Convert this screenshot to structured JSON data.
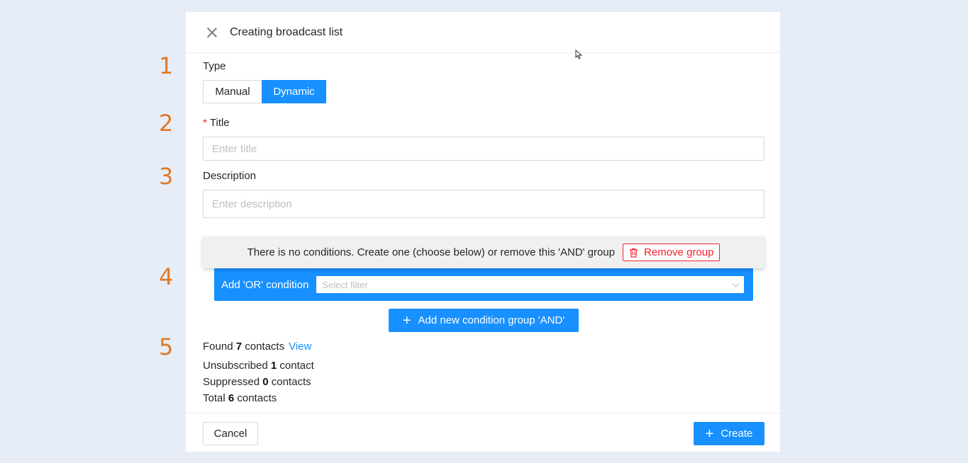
{
  "steps": [
    "1",
    "2",
    "3",
    "4",
    "5"
  ],
  "modal": {
    "title": "Creating broadcast list"
  },
  "type_field": {
    "label": "Type",
    "options": [
      "Manual",
      "Dynamic"
    ],
    "selected": "Dynamic"
  },
  "title_field": {
    "required_mark": "*",
    "label": "Title",
    "value": "",
    "placeholder": "Enter title"
  },
  "description_field": {
    "label": "Description",
    "value": "",
    "placeholder": "Enter description"
  },
  "condition_group": {
    "empty_message": "There is no conditions. Create one (choose below) or remove this 'AND' group",
    "remove_label": "Remove group",
    "or_label": "Add 'OR' condition",
    "select_placeholder": "Select filter"
  },
  "add_group_label": "Add new condition group 'AND'",
  "stats": {
    "found_prefix": "Found",
    "found_count": "7",
    "found_suffix": "contacts",
    "view_label": "View",
    "unsubscribed_prefix": "Unsubscribed",
    "unsubscribed_count": "1",
    "unsubscribed_suffix": "contact",
    "suppressed_prefix": "Suppressed",
    "suppressed_count": "0",
    "suppressed_suffix": "contacts",
    "total_prefix": "Total",
    "total_count": "6",
    "total_suffix": "contacts"
  },
  "footer": {
    "cancel_label": "Cancel",
    "create_label": "Create"
  },
  "colors": {
    "primary": "#1890ff",
    "danger": "#f5222d",
    "step_number": "#e07a24",
    "background": "#e6edf7"
  },
  "icons": {
    "close": "close-icon",
    "trash": "trash-icon",
    "chevron": "chevron-down-icon",
    "plus": "plus-icon"
  }
}
